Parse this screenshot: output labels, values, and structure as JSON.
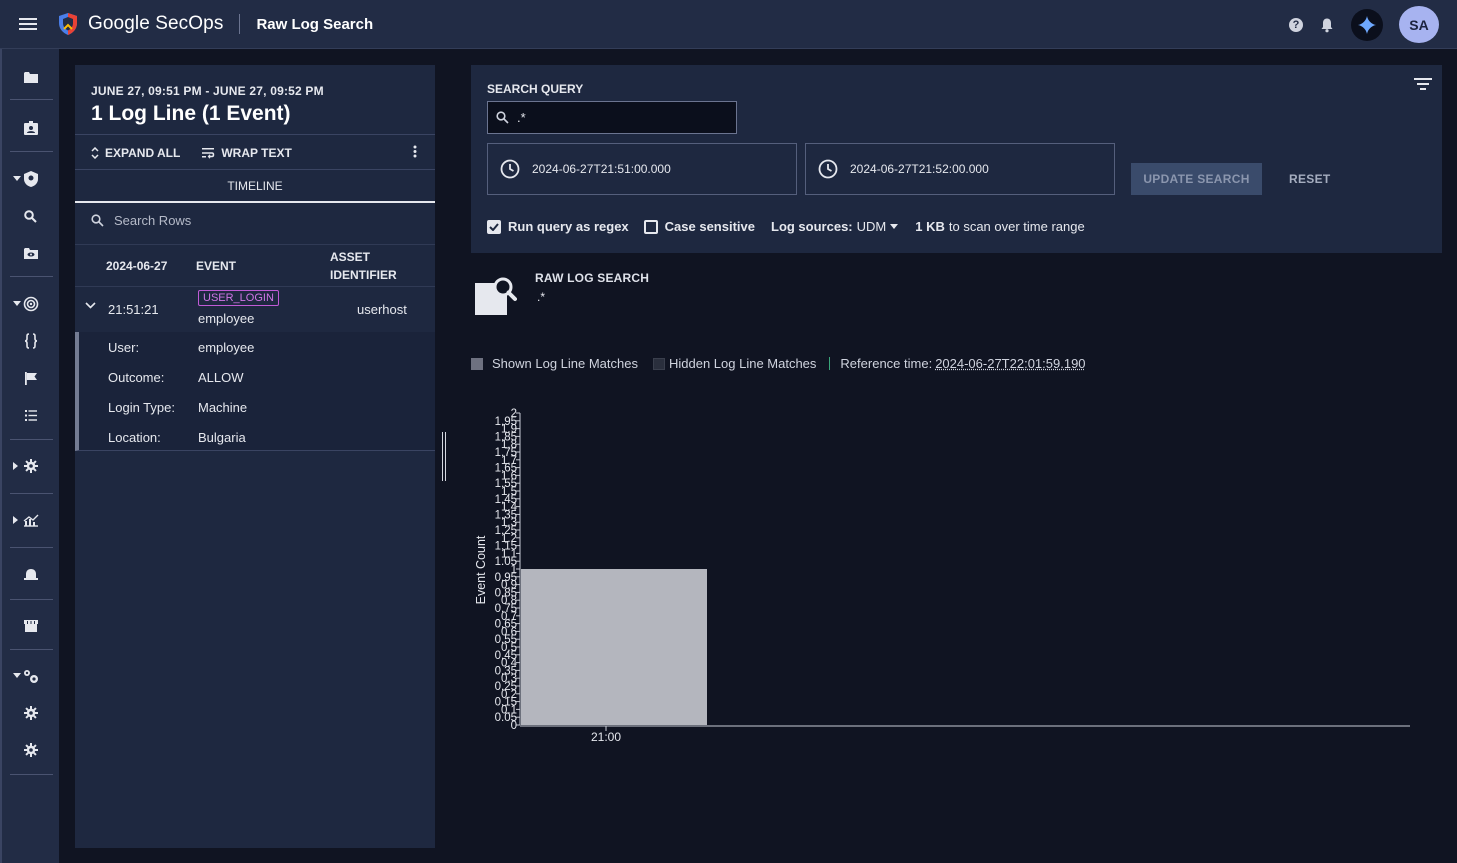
{
  "header": {
    "brand": "Google SecOps",
    "page_title": "Raw Log Search",
    "avatar_initials": "SA",
    "icons": [
      "menu-icon",
      "secops-shield-logo",
      "help-icon",
      "bell-icon",
      "gemini-spark-icon"
    ]
  },
  "sidebar": {
    "icons": [
      "folder-icon",
      "contact-card-icon",
      "shield-icon",
      "search-icon",
      "folder-eye-icon",
      "radar-icon",
      "braces-icon",
      "flag-icon",
      "list-icon",
      "gear-icon",
      "chart-icon",
      "bell-alarm-icon",
      "store-icon",
      "gears-icon",
      "gear-icon",
      "gear-icon"
    ]
  },
  "left_panel": {
    "range": "JUNE 27, 09:51 PM - JUNE 27, 09:52 PM",
    "title": "1 Log Line (1 Event)",
    "expand_all": "EXPAND ALL",
    "wrap_text": "WRAP TEXT",
    "tab": "TIMELINE",
    "search_placeholder": "Search Rows",
    "columns": {
      "date": "2024-06-27",
      "event": "EVENT",
      "asset": "ASSET IDENTIFIER"
    },
    "row": {
      "time": "21:51:21",
      "badge": "USER_LOGIN",
      "user": "employee",
      "asset": "userhost"
    },
    "details": [
      {
        "label": "User:",
        "value": "employee"
      },
      {
        "label": "Outcome:",
        "value": "ALLOW"
      },
      {
        "label": "Login Type:",
        "value": "Machine"
      },
      {
        "label": "Location:",
        "value": "Bulgaria"
      }
    ]
  },
  "query": {
    "label": "SEARCH QUERY",
    "value": ".*",
    "start": "2024-06-27T21:51:00.000",
    "end": "2024-06-27T21:52:00.000",
    "update_button": "UPDATE SEARCH",
    "reset_button": "RESET",
    "regex_label": "Run query as regex",
    "regex_checked": true,
    "case_label": "Case sensitive",
    "case_checked": false,
    "log_sources_label": "Log sources:",
    "log_sources_value": "UDM",
    "scan_bold": "1 KB",
    "scan_text": "to scan over time range"
  },
  "raw_log": {
    "title": "RAW LOG SEARCH",
    "query_display": ".*"
  },
  "legend": {
    "shown": "Shown Log Line Matches",
    "hidden": "Hidden Log Line Matches",
    "reference_label": "Reference time:",
    "reference_value": "2024-06-27T22:01:59.190",
    "shown_color": "#b4b6be",
    "hidden_color": "#2a2f3d"
  },
  "chart_data": {
    "type": "bar",
    "categories": [
      "21:00"
    ],
    "values": [
      1
    ],
    "xlabel": "",
    "ylabel": "Event Count",
    "ylim": [
      0,
      2
    ],
    "yticks": [
      "0",
      "0.05",
      "0.1",
      "0.15",
      "0.2",
      "0.25",
      "0.3",
      "0.35",
      "0.4",
      "0.45",
      "0.5",
      "0.55",
      "0.6",
      "0.65",
      "0.7",
      "0.75",
      "0.8",
      "0.85",
      "0.9",
      "0.95",
      "1",
      "1.05",
      "1.1",
      "1.15",
      "1.2",
      "1.25",
      "1.3",
      "1.35",
      "1.4",
      "1.45",
      "1.5",
      "1.55",
      "1.6",
      "1.65",
      "1.7",
      "1.75",
      "1.8",
      "1.85",
      "1.9",
      "1.95",
      "2"
    ],
    "bar_color": "#b4b6be"
  }
}
